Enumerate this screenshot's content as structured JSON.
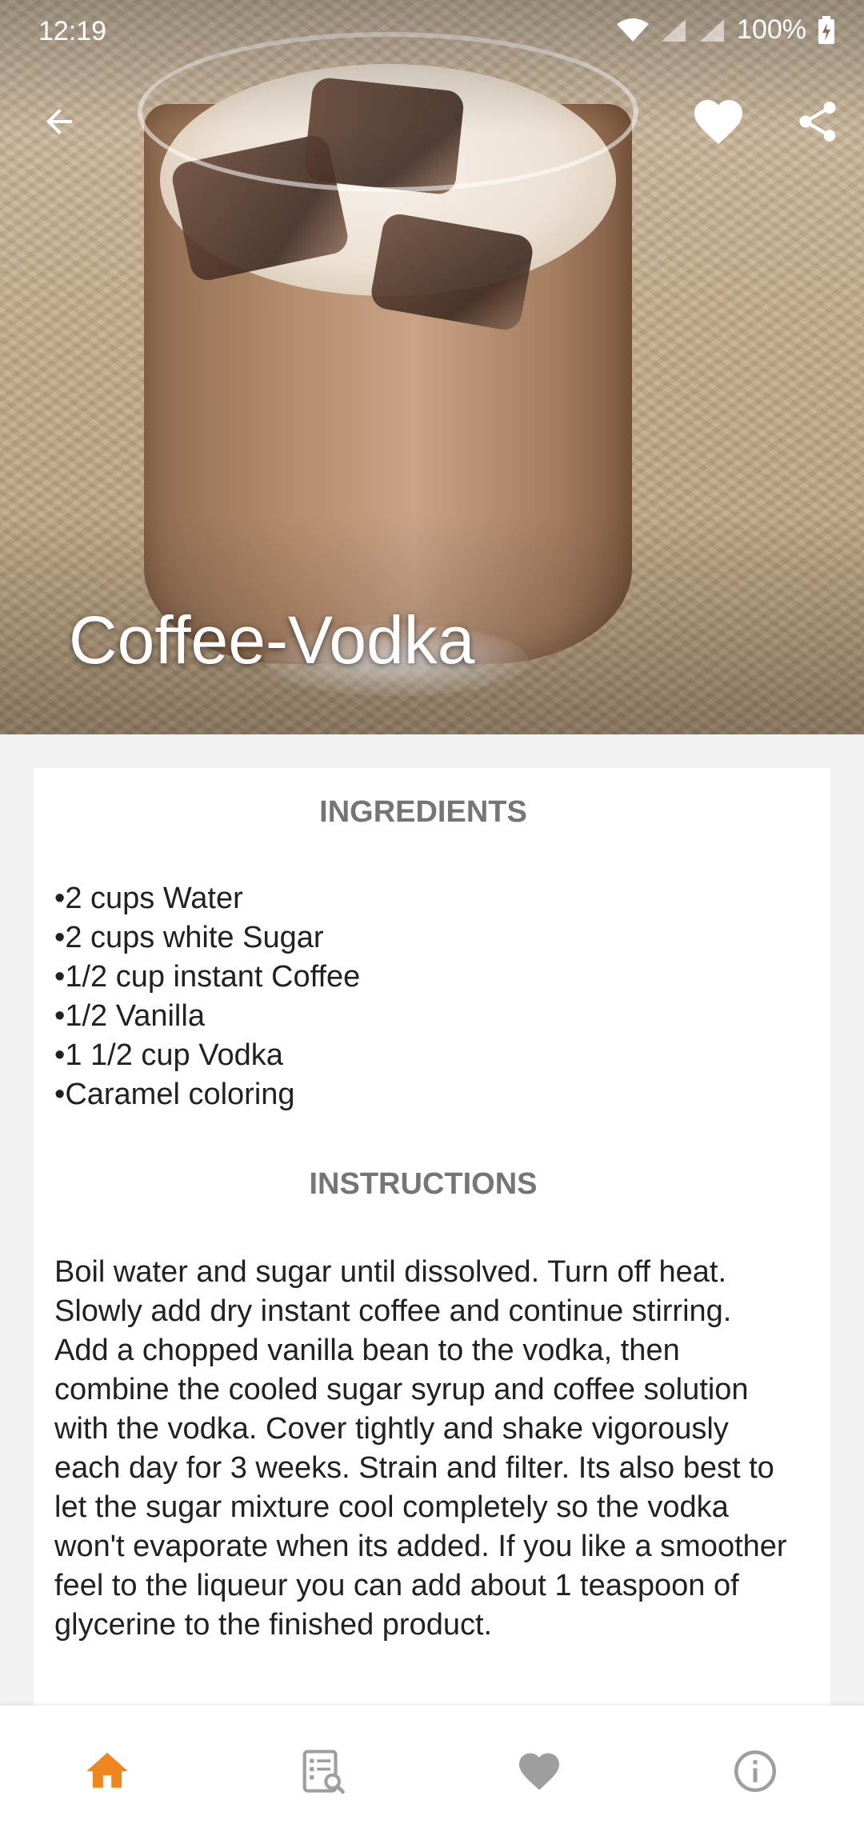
{
  "status_bar": {
    "time": "12:19",
    "battery": "100%"
  },
  "app_bar": {
    "back_icon": "arrow-back-icon",
    "favorite_icon": "heart-icon",
    "share_icon": "share-icon"
  },
  "recipe": {
    "title": "Coffee-Vodka",
    "ingredients_heading": "INGREDIENTS",
    "ingredients": [
      "2 cups  Water",
      "2 cups white  Sugar",
      "1/2 cup instant  Coffee",
      "1/2 Vanilla",
      "1 1/2 cup Vodka",
      "Caramel coloring"
    ],
    "instructions_heading": "INSTRUCTIONS",
    "instructions": "Boil water and sugar until dissolved. Turn off heat. Slowly add dry instant coffee and continue stirring. Add a chopped vanilla bean to the vodka, then combine the cooled sugar syrup and coffee solution with the vodka. Cover tightly and shake vigorously each day for 3 weeks. Strain and filter. Its also best to let the sugar mixture cool completely so the vodka won't evaporate when its added. If you like a smoother feel to the liqueur you can add about 1 teaspoon of glycerine to the finished product."
  },
  "bottom_nav": {
    "items": [
      {
        "icon": "home-icon",
        "active": true
      },
      {
        "icon": "recipe-search-icon",
        "active": false
      },
      {
        "icon": "favorites-heart-icon",
        "active": false
      },
      {
        "icon": "info-icon",
        "active": false
      }
    ]
  },
  "colors": {
    "accent": "#f0861e",
    "inactive_icon": "#9e9e9e",
    "heading": "#757575",
    "body_text": "#212121"
  }
}
